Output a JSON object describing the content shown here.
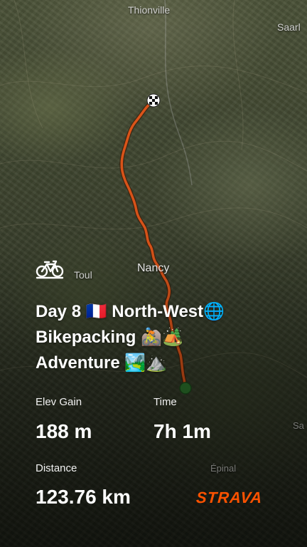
{
  "map": {
    "places": {
      "thionville": "Thionville",
      "saarl": "Saarl",
      "toul": "Toul",
      "nancy": "Nancy",
      "sa": "Sa",
      "epinal": "Épinal"
    }
  },
  "activity": {
    "icon": "bike-icon",
    "title_lines": [
      "Day 8 🇫🇷 North-West🌐",
      "Bikepacking 🚵🏕️",
      "Adventure 🏞️⛰️"
    ]
  },
  "stats": {
    "elev_gain": {
      "label": "Elev Gain",
      "value": "188 m"
    },
    "time": {
      "label": "Time",
      "value": "7h 1m"
    },
    "distance": {
      "label": "Distance",
      "value": "123.76 km"
    }
  },
  "brand": {
    "name": "STRAVA",
    "color": "#fc5200"
  },
  "colors": {
    "route": "#e0561a",
    "text": "#ffffff"
  }
}
